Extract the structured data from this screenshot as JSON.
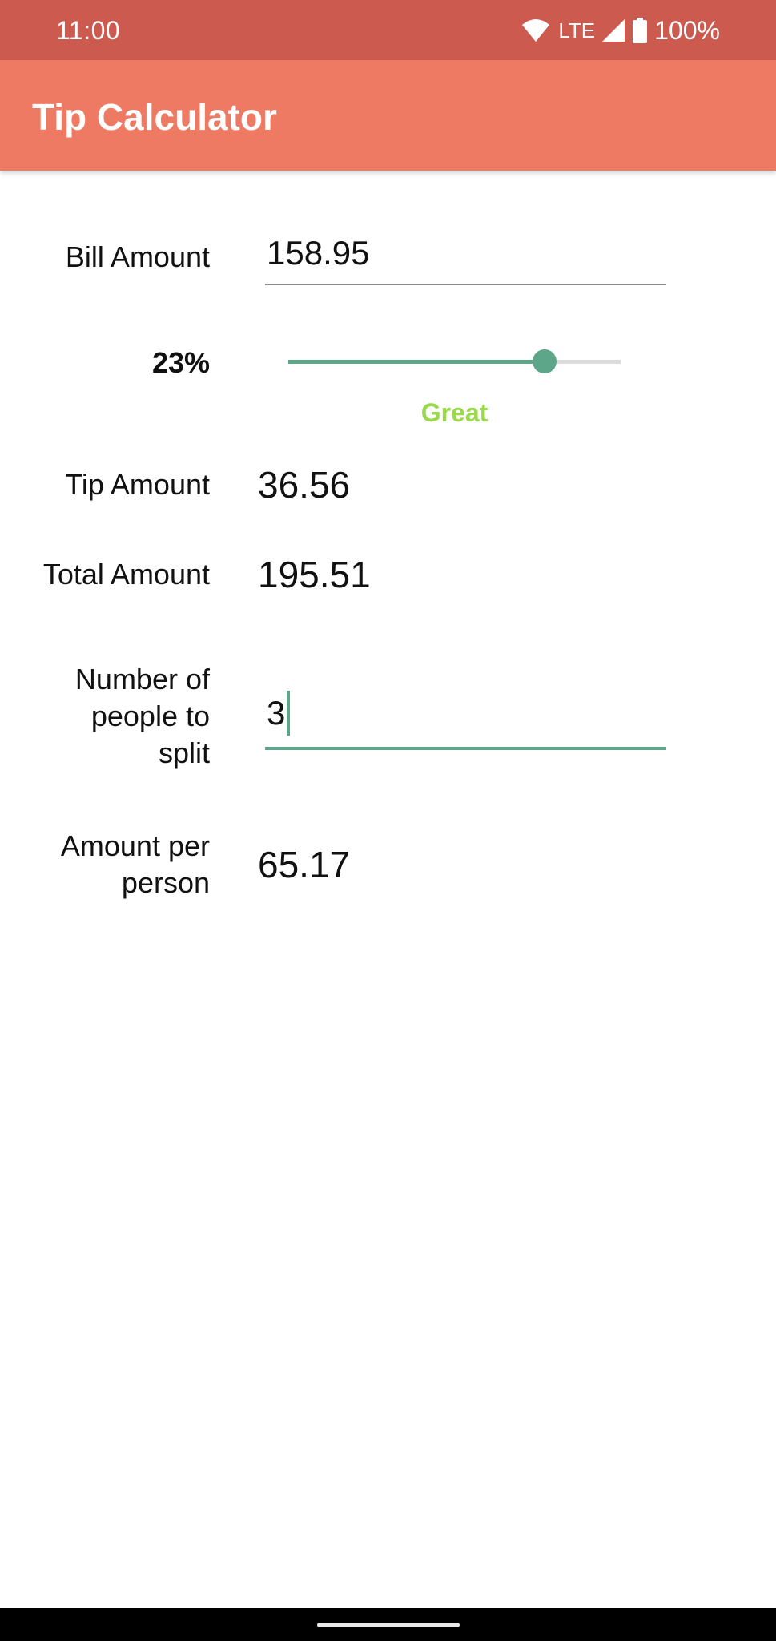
{
  "status_bar": {
    "time": "11:00",
    "network": "LTE",
    "battery": "100%"
  },
  "app_bar": {
    "title": "Tip Calculator"
  },
  "form": {
    "bill_label": "Bill Amount",
    "bill_value": "158.95",
    "tip_percent": "23%",
    "tip_percent_value": 23,
    "tip_slider_fraction": 0.77,
    "tip_description": "Great",
    "tip_amount_label": "Tip Amount",
    "tip_amount_value": "36.56",
    "total_label": "Total Amount",
    "total_value": "195.51",
    "split_label_line1": "Number of",
    "split_label_line2": "people to",
    "split_label_line3": "split",
    "split_value": "3",
    "per_person_label_line1": "Amount per",
    "per_person_label_line2": "person",
    "per_person_value": "65.17"
  },
  "colors": {
    "status_bar": "#cd5a4f",
    "app_bar": "#ef7a63",
    "accent": "#5ea68a",
    "tip_description": "#9ad94a"
  },
  "icons": [
    "wifi-icon",
    "signal-icon",
    "battery-icon"
  ]
}
